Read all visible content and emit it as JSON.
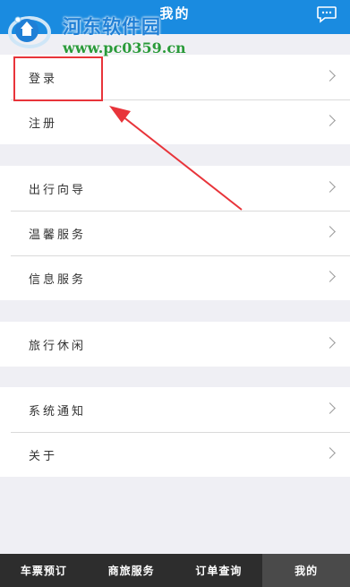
{
  "header": {
    "title": "我的"
  },
  "watermark": {
    "title": "河东软件园",
    "url": "www.pc0359.cn"
  },
  "groups": [
    {
      "items": [
        {
          "label": "登录"
        },
        {
          "label": "注册"
        }
      ]
    },
    {
      "items": [
        {
          "label": "出行向导"
        },
        {
          "label": "温馨服务"
        },
        {
          "label": "信息服务"
        }
      ]
    },
    {
      "items": [
        {
          "label": "旅行休闲"
        }
      ]
    },
    {
      "items": [
        {
          "label": "系统通知"
        },
        {
          "label": "关于"
        }
      ]
    }
  ],
  "tabbar": {
    "tabs": [
      {
        "label": "车票预订"
      },
      {
        "label": "商旅服务"
      },
      {
        "label": "订单查询"
      },
      {
        "label": "我的"
      }
    ],
    "active": "我的"
  },
  "colors": {
    "header": "#1a8be0",
    "page_background": "#efeff4",
    "annotation": "#e8343a",
    "tabbar": "#2d2d2d",
    "tabbar_active": "#4a4a4a"
  },
  "icons": {
    "header_right": "message-icon",
    "row_chevron": "chevron-right-icon"
  }
}
